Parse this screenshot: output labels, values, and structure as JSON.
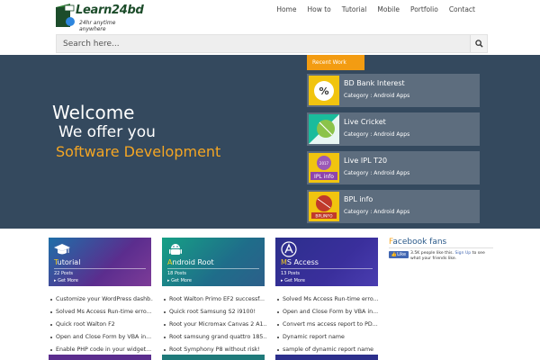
{
  "brand": {
    "name": "Learn24bd",
    "tagline": "24hr anytime anywhere"
  },
  "nav": {
    "items": [
      "Home",
      "How to",
      "Tutorial",
      "Mobile",
      "Portfolio",
      "Contact"
    ]
  },
  "search": {
    "placeholder": "Search here..."
  },
  "hero": {
    "line1": "Welcome",
    "line2": "We offer you",
    "line3": "Software Development"
  },
  "recent": {
    "tab_label": "Recent Work",
    "items": [
      {
        "title": "BD Bank Interest",
        "category": "Category : Android Apps",
        "icon": "percent-icon"
      },
      {
        "title": "Live Cricket",
        "category": "Category : Android Apps",
        "icon": "cricket-ball-icon"
      },
      {
        "title": "Live IPL T20",
        "category": "Category : Android Apps",
        "icon": "ipl-info-icon",
        "icon_text": "IPL info",
        "badge_text": "2017"
      },
      {
        "title": "BPL info",
        "category": "Category : Android Apps",
        "icon": "bpl-info-icon",
        "icon_text": "BPLINFO"
      }
    ]
  },
  "categories": [
    {
      "first": "T",
      "rest": "utorial",
      "count": "22 Posts",
      "more": "Get More",
      "icon": "graduation-cap-icon"
    },
    {
      "first": "A",
      "rest": "ndroid Root",
      "count": "18 Posts",
      "more": "Get More",
      "icon": "android-icon"
    },
    {
      "first": "M",
      "rest": "S Access",
      "count": "13 Posts",
      "more": "Get More",
      "icon": "ms-access-icon"
    }
  ],
  "posts": [
    [
      "Customize your WordPress dashb...",
      "Solved Ms Access Run-time erro...",
      "Quick root Walton F2",
      "Open and Close Form by VBA in...",
      "Enable PHP code in your widget..."
    ],
    [
      "Root Walton Primo EF2 successf...",
      "Quick root Samsung S2 i9100!",
      "Root your Micromax Canvas 2 A1...",
      "Root samsung grand quattro 185...",
      "Root Symphony P8 without risk!"
    ],
    [
      "Solved Ms Access Run-time erro...",
      "Open and Close Form by VBA in...",
      "Convert ms access report to PD...",
      "Dynamic report name",
      "sample of dynamic report name"
    ]
  ],
  "facebook": {
    "title_first": "F",
    "title_rest": "acebook fans",
    "like_label": "Like",
    "text_before": "3.5K people like this.",
    "signup": "Sign Up",
    "text_after": "to see what your friends like."
  },
  "colors": {
    "hero_bg": "#34495e",
    "accent": "#f5a623",
    "recent_tab": "#f39c12",
    "card_tutorial": "#5b2d8e",
    "card_android": "#1f7a7a",
    "card_access": "#2c2f8c"
  }
}
